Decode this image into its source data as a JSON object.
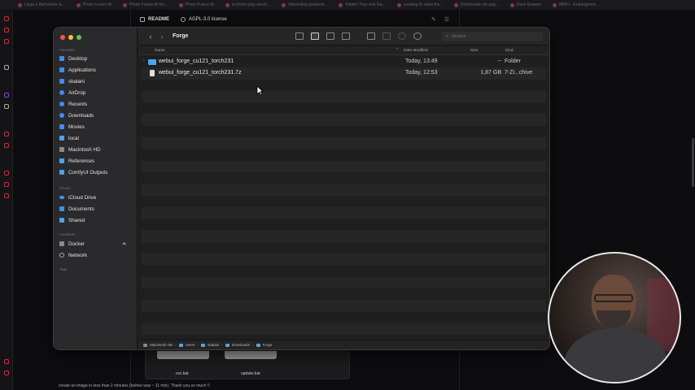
{
  "browser": {
    "bookmarks": [
      "Llega a Barcelona la...",
      "Photo Fusion AI",
      "Photo Fusion AI fot...",
      "Photo Fusion AI",
      "ai photo gray servic...",
      "Interesting products...",
      "Inhafer Toys and Ga...",
      "Leading AI video fra...",
      "Distribución de pag...",
      "Dove Esaene",
      "MIRO - Endangered..."
    ],
    "readme_tab": "README",
    "license_tab": "AGPL-3.0 license",
    "dock_files": [
      "run.bat",
      "update.bat"
    ],
    "comment": "create an image in less than 2 minutes (before was ~ 11 min). Thank you so much !!"
  },
  "finder": {
    "title": "Forge",
    "search_placeholder": "Search",
    "sidebar": {
      "favorites_label": "Favorites",
      "favorites": [
        {
          "label": "Desktop",
          "icon": "desktop-icon"
        },
        {
          "label": "Applications",
          "icon": "applications-icon"
        },
        {
          "label": "sbalani",
          "icon": "home-icon"
        },
        {
          "label": "AirDrop",
          "icon": "airdrop-icon"
        },
        {
          "label": "Recents",
          "icon": "recents-icon"
        },
        {
          "label": "Downloads",
          "icon": "downloads-icon"
        },
        {
          "label": "Movies",
          "icon": "movies-icon"
        },
        {
          "label": "local",
          "icon": "folder-icon"
        },
        {
          "label": "Macintosh HD",
          "icon": "drive-icon"
        },
        {
          "label": "References",
          "icon": "folder-icon"
        },
        {
          "label": "ComfyUI Outputs",
          "icon": "folder-icon"
        }
      ],
      "icloud_label": "iCloud",
      "icloud": [
        {
          "label": "iCloud Drive",
          "icon": "cloud-icon"
        },
        {
          "label": "Documents",
          "icon": "document-icon"
        },
        {
          "label": "Shared",
          "icon": "shared-icon"
        }
      ],
      "locations_label": "Locations",
      "locations": [
        {
          "label": "Docker",
          "icon": "drive-icon"
        },
        {
          "label": "Network",
          "icon": "globe-icon"
        }
      ],
      "tags_label": "Tags"
    },
    "columns": {
      "name": "Name",
      "date": "Date Modified",
      "size": "Size",
      "kind": "Kind"
    },
    "files": [
      {
        "name": "webui_forge_cu121_torch231",
        "date": "Today, 13:49",
        "size": "--",
        "kind": "Folder",
        "icon": "folder-icon"
      },
      {
        "name": "webui_forge_cu121_torch231.7z",
        "date": "Today, 12:53",
        "size": "1,87 GB",
        "kind": "7-Zi...chive",
        "icon": "archive-icon"
      }
    ],
    "path": [
      "Macintosh HD",
      "Users",
      "sbalani",
      "Downloads",
      "Forge"
    ]
  }
}
